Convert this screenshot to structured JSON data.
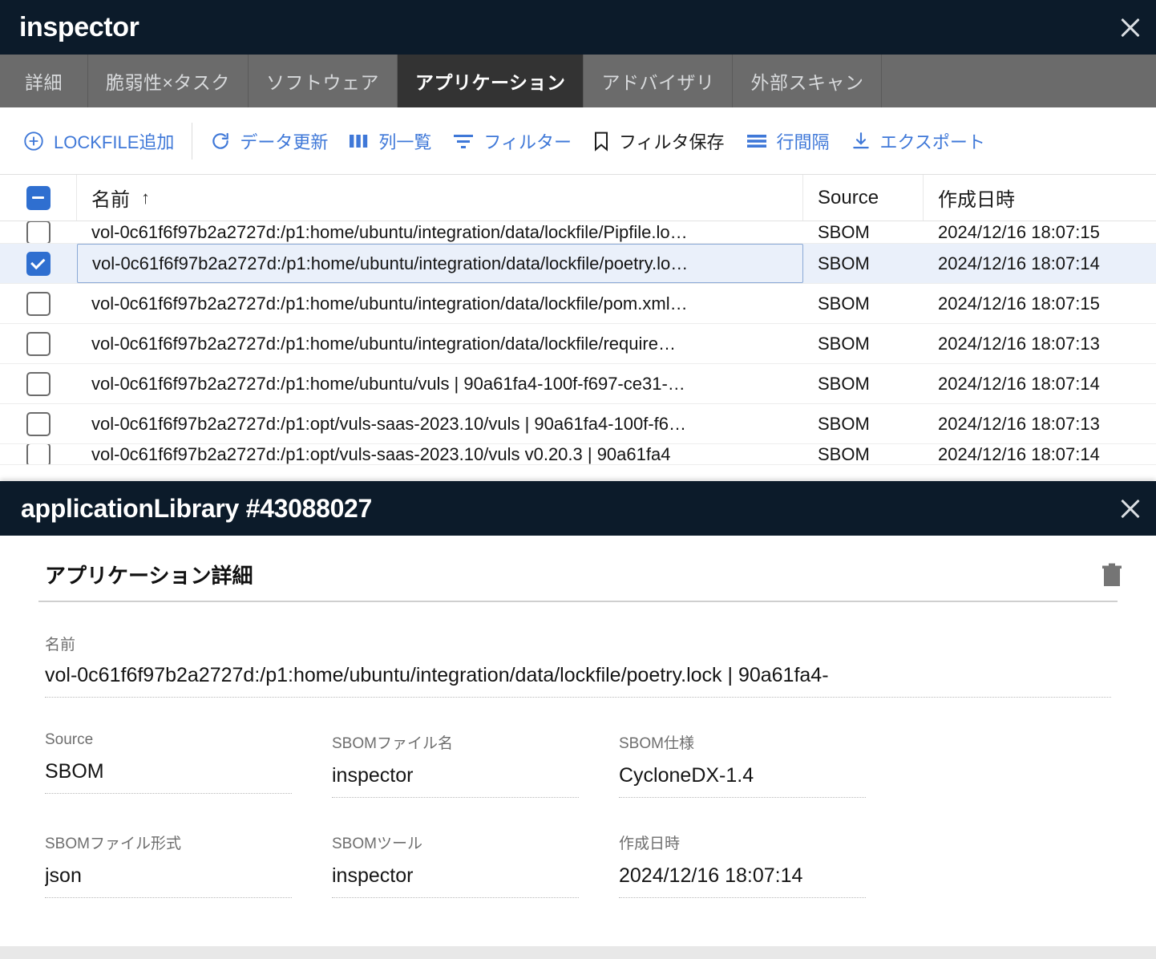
{
  "window": {
    "app_title": "inspector",
    "close_icon": "close-icon"
  },
  "tabs": [
    {
      "label": "詳細",
      "active": false
    },
    {
      "label": "脆弱性×タスク",
      "active": false
    },
    {
      "label": "ソフトウェア",
      "active": false
    },
    {
      "label": "アプリケーション",
      "active": true
    },
    {
      "label": "アドバイザリ",
      "active": false
    },
    {
      "label": "外部スキャン",
      "active": false
    }
  ],
  "toolbar": {
    "add_lockfile": "LOCKFILE追加",
    "refresh": "データ更新",
    "columns": "列一覧",
    "filter": "フィルター",
    "save_filter": "フィルタ保存",
    "row_spacing": "行間隔",
    "export": "エクスポート",
    "accent_color": "#3f78d8",
    "icons": {
      "add": "plus-circle-icon",
      "refresh": "refresh-icon",
      "columns": "columns-icon",
      "filter": "filter-icon",
      "save_filter": "bookmark-icon",
      "row_spacing": "density-icon",
      "export": "download-icon"
    }
  },
  "table": {
    "headers": {
      "name": "名前",
      "source": "Source",
      "created": "作成日時",
      "sort_indicator": "↑"
    },
    "select_all_state": "indeterminate",
    "rows": [
      {
        "checked": false,
        "clipped": "top",
        "name": "vol-0c61f6f97b2a2727d:/p1:home/ubuntu/integration/data/lockfile/Pipfile.lo…",
        "source": "SBOM",
        "created": "2024/12/16 18:07:15"
      },
      {
        "checked": true,
        "selected": true,
        "name": "vol-0c61f6f97b2a2727d:/p1:home/ubuntu/integration/data/lockfile/poetry.lo…",
        "source": "SBOM",
        "created": "2024/12/16 18:07:14"
      },
      {
        "checked": false,
        "name": "vol-0c61f6f97b2a2727d:/p1:home/ubuntu/integration/data/lockfile/pom.xml…",
        "source": "SBOM",
        "created": "2024/12/16 18:07:15"
      },
      {
        "checked": false,
        "name": "vol-0c61f6f97b2a2727d:/p1:home/ubuntu/integration/data/lockfile/require…",
        "source": "SBOM",
        "created": "2024/12/16 18:07:13"
      },
      {
        "checked": false,
        "name": "vol-0c61f6f97b2a2727d:/p1:home/ubuntu/vuls | 90a61fa4-100f-f697-ce31-…",
        "source": "SBOM",
        "created": "2024/12/16 18:07:14"
      },
      {
        "checked": false,
        "name": "vol-0c61f6f97b2a2727d:/p1:opt/vuls-saas-2023.10/vuls | 90a61fa4-100f-f6…",
        "source": "SBOM",
        "created": "2024/12/16 18:07:13"
      },
      {
        "checked": false,
        "clipped": "bottom",
        "name": "vol-0c61f6f97b2a2727d:/p1:opt/vuls-saas-2023.10/vuls v0.20.3 | 90a61fa4",
        "source": "SBOM",
        "created": "2024/12/16 18:07:14"
      }
    ]
  },
  "detail": {
    "header_title": "applicationLibrary #43088027",
    "close_icon": "close-icon",
    "section_title": "アプリケーション詳細",
    "delete_icon": "trash-icon",
    "name_label": "名前",
    "name_value": "vol-0c61f6f97b2a2727d:/p1:home/ubuntu/integration/data/lockfile/poetry.lock | 90a61fa4-",
    "fields_row1": [
      {
        "label": "Source",
        "value": "SBOM"
      },
      {
        "label": "SBOMファイル名",
        "value": "inspector"
      },
      {
        "label": "SBOM仕様",
        "value": "CycloneDX-1.4"
      }
    ],
    "fields_row2": [
      {
        "label": "SBOMファイル形式",
        "value": "json"
      },
      {
        "label": "SBOMツール",
        "value": "inspector"
      },
      {
        "label": "作成日時",
        "value": "2024/12/16 18:07:14"
      }
    ]
  }
}
